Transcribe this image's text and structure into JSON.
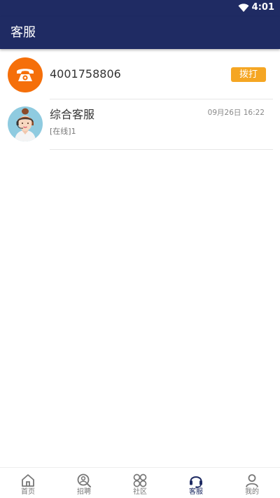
{
  "status_bar": {
    "time": "4:01",
    "wifi_icon": "wifi-icon"
  },
  "app_bar": {
    "title": "客服"
  },
  "hotline": {
    "icon": "telephone-icon",
    "number": "4001758806",
    "dial_label": "拨打"
  },
  "chat": {
    "name": "综合客服",
    "time": "09月26日 16:22",
    "status": "[在线]1"
  },
  "bottom_nav": {
    "items": [
      {
        "label": "首页",
        "icon": "home-icon"
      },
      {
        "label": "招聘",
        "icon": "recruit-search-icon"
      },
      {
        "label": "社区",
        "icon": "community-icon"
      },
      {
        "label": "客服",
        "icon": "headset-icon"
      },
      {
        "label": "我的",
        "icon": "profile-icon"
      }
    ],
    "active_index": 3
  },
  "colors": {
    "primary": "#1f2b63",
    "phone_avatar": "#f56f0a",
    "dial_button": "#f5a623",
    "agent_avatar_bg": "#8fcbe0"
  }
}
